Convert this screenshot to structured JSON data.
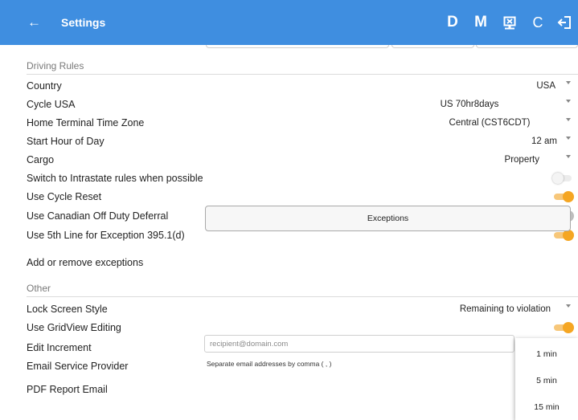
{
  "appbar": {
    "title": "Settings",
    "back_glyph": "←",
    "actions": {
      "d_label": "D",
      "m_label": "M",
      "report_icon": "report-upload-icon",
      "refresh_glyph": "C",
      "logout_icon": "logout-icon"
    },
    "color": "#3f8ee0"
  },
  "driving_rules": {
    "header": "Driving Rules",
    "country": {
      "label": "Country",
      "value": "USA"
    },
    "cycle": {
      "label": "Cycle USA",
      "value": "US 70hr8days"
    },
    "time_zone": {
      "label": "Home Terminal Time Zone",
      "value": "Central (CST6CDT)"
    },
    "start_hour": {
      "label": "Start Hour of Day",
      "value": "12 am"
    },
    "cargo": {
      "label": "Cargo",
      "value": "Property"
    },
    "intrastate": {
      "label": "Switch to Intrastate rules when possible",
      "on": false,
      "enabled": false
    },
    "cycle_reset": {
      "label": "Use Cycle Reset",
      "on": true
    },
    "canadian_deferral": {
      "label": "Use Canadian Off Duty Deferral",
      "on": false
    },
    "fifth_line": {
      "label": "Use 5th Line for Exception 395.1(d)",
      "on": true
    },
    "exceptions": {
      "label": "Add or remove exceptions",
      "button_label": "Exceptions"
    }
  },
  "other": {
    "header": "Other",
    "lock_screen": {
      "label": "Lock Screen Style",
      "value": "Remaining to violation"
    },
    "gridview": {
      "label": "Use GridView Editing",
      "on": true
    },
    "edit_increment": {
      "label": "Edit Increment"
    },
    "email_provider": {
      "label": "Email Service Provider"
    },
    "pdf_email": {
      "label": "PDF Report Email",
      "placeholder": "recipient@domain.com",
      "value": "",
      "hint": "Separate email addresses by comma ( , )"
    }
  },
  "increment_dropdown": {
    "options": [
      "1 min",
      "5 min",
      "15 min"
    ]
  },
  "colors": {
    "toggle_on_thumb": "#f5a623",
    "toggle_on_track": "#f7c77a",
    "toggle_off_thumb": "#bdbdbd",
    "toggle_off_track": "#e2e2e2"
  }
}
